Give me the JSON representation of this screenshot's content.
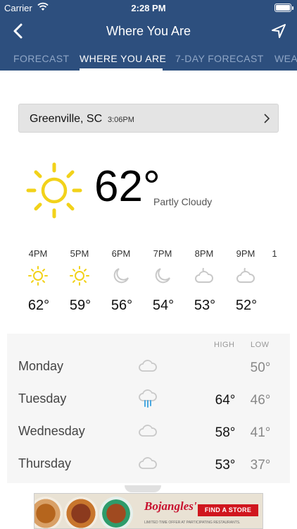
{
  "status_bar": {
    "carrier": "Carrier",
    "time": "2:28 PM"
  },
  "nav": {
    "title": "Where You Are"
  },
  "tabs": [
    {
      "label": "FORECAST"
    },
    {
      "label": "WHERE YOU ARE",
      "active": true
    },
    {
      "label": "7-DAY FORECAST"
    },
    {
      "label": "WEA"
    }
  ],
  "location": {
    "city": "Greenville, SC",
    "time": "3:06PM"
  },
  "current": {
    "icon": "sun-icon",
    "temp": "62°",
    "condition": "Partly Cloudy"
  },
  "hourly": [
    {
      "time": "4PM",
      "icon": "sun-icon",
      "temp": "62°"
    },
    {
      "time": "5PM",
      "icon": "sun-icon",
      "temp": "59°"
    },
    {
      "time": "6PM",
      "icon": "moon-icon",
      "temp": "56°"
    },
    {
      "time": "7PM",
      "icon": "moon-icon",
      "temp": "54°"
    },
    {
      "time": "8PM",
      "icon": "cloud-moon-icon",
      "temp": "53°"
    },
    {
      "time": "9PM",
      "icon": "cloud-moon-icon",
      "temp": "52°"
    },
    {
      "time": "1",
      "icon": "",
      "temp": ""
    }
  ],
  "daily": {
    "high_label": "HIGH",
    "low_label": "LOW",
    "days": [
      {
        "day": "Monday",
        "icon": "cloud-icon",
        "high": "",
        "low": "50°"
      },
      {
        "day": "Tuesday",
        "icon": "rain-cloud-icon",
        "high": "64°",
        "low": "46°"
      },
      {
        "day": "Wednesday",
        "icon": "cloud-icon",
        "high": "58°",
        "low": "41°"
      },
      {
        "day": "Thursday",
        "icon": "cloud-icon",
        "high": "53°",
        "low": "37°"
      }
    ]
  },
  "ad": {
    "brand": "Bojangles'",
    "cta": "FIND A STORE",
    "fine_print": "LIMITED TIME OFFER AT PARTICIPATING RESTAURANTS."
  },
  "colors": {
    "nav_bg": "#2d4f7e",
    "tab_inactive": "#8fa6c6",
    "sun": "#f2d21a",
    "rain": "#4aa8e0",
    "ad_red": "#d0161e"
  }
}
